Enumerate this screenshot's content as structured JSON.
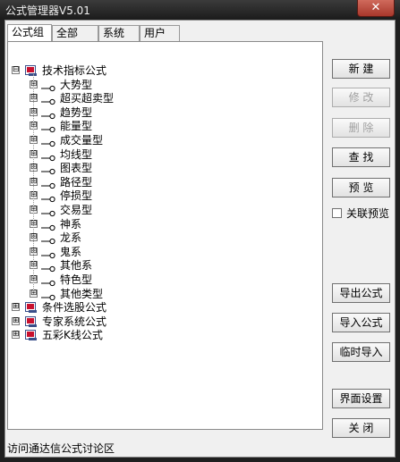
{
  "window": {
    "title": "公式管理器V5.01",
    "close_icon": "close-icon"
  },
  "tabs": [
    {
      "label": "公式组",
      "active": true
    },
    {
      "label": "全部",
      "active": false
    },
    {
      "label": "系统",
      "active": false
    },
    {
      "label": "用户",
      "active": false
    }
  ],
  "tree": {
    "root": {
      "label": "技术指标公式",
      "expander": "⊟"
    },
    "children": [
      {
        "label": "大势型",
        "expander": "⊞"
      },
      {
        "label": "超买超卖型",
        "expander": "⊞"
      },
      {
        "label": "趋势型",
        "expander": "⊞"
      },
      {
        "label": "能量型",
        "expander": "⊞"
      },
      {
        "label": "成交量型",
        "expander": "⊞"
      },
      {
        "label": "均线型",
        "expander": "⊞"
      },
      {
        "label": "图表型",
        "expander": "⊞"
      },
      {
        "label": "路径型",
        "expander": "⊞"
      },
      {
        "label": "停损型",
        "expander": "⊞"
      },
      {
        "label": "交易型",
        "expander": "⊞"
      },
      {
        "label": "神系",
        "expander": "⊞"
      },
      {
        "label": "龙系",
        "expander": "⊞"
      },
      {
        "label": "鬼系",
        "expander": "⊞"
      },
      {
        "label": "其他系",
        "expander": "⊞"
      },
      {
        "label": "特色型",
        "expander": "⊞"
      },
      {
        "label": "其他类型",
        "expander": "⊞"
      }
    ],
    "others": [
      {
        "label": "条件选股公式",
        "expander": "⊞"
      },
      {
        "label": "专家系统公式",
        "expander": "⊞"
      },
      {
        "label": "五彩K线公式",
        "expander": "⊞"
      }
    ]
  },
  "buttons": {
    "new": "新  建",
    "edit": "修  改",
    "delete": "删  除",
    "find": "查  找",
    "preview": "预  览",
    "export": "导出公式",
    "import": "导入公式",
    "temp_import": "临时导入",
    "ui_settings": "界面设置",
    "close": "关  闭"
  },
  "preview_checkbox": {
    "label": "关联预览",
    "checked": false
  },
  "status": {
    "text": "访问通达信公式讨论区"
  },
  "colors": {
    "titlebar": "#2a2a2a",
    "close": "#c0483a",
    "folder_red": "#c8102e",
    "folder_blue": "#3a4f8a"
  }
}
